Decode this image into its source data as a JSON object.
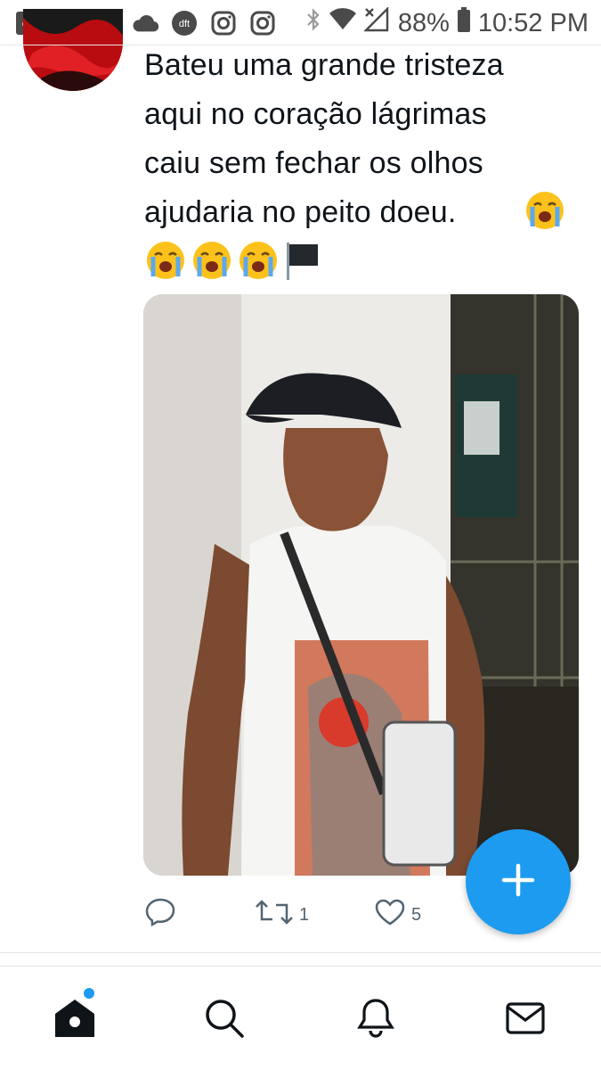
{
  "status_bar": {
    "battery_percent": "88%",
    "time": "10:52 PM",
    "left_icons": [
      "facebook-icon",
      "facebook-icon",
      "twitter-icon",
      "cloud-icon",
      "dft-icon",
      "instagram-icon",
      "instagram-icon"
    ],
    "dft_label": "dft"
  },
  "tweet": {
    "text_lines": [
      "Bateu uma grande tristeza",
      "aqui no coração lágrimas",
      "caiu sem fechar os olhos",
      "ajudaria no peito doeu."
    ],
    "emojis": [
      "loudly-crying-face-icon",
      "loudly-crying-face-icon",
      "loudly-crying-face-icon",
      "black-flag-icon"
    ],
    "actions": {
      "reply_count": "",
      "retweet_count": "1",
      "like_count": "5"
    }
  },
  "bottom_nav": {
    "items": [
      "home-icon",
      "search-icon",
      "notifications-icon",
      "messages-icon"
    ]
  },
  "colors": {
    "accent": "#1d9bf0",
    "text": "#0f1419",
    "secondary": "#536471"
  }
}
